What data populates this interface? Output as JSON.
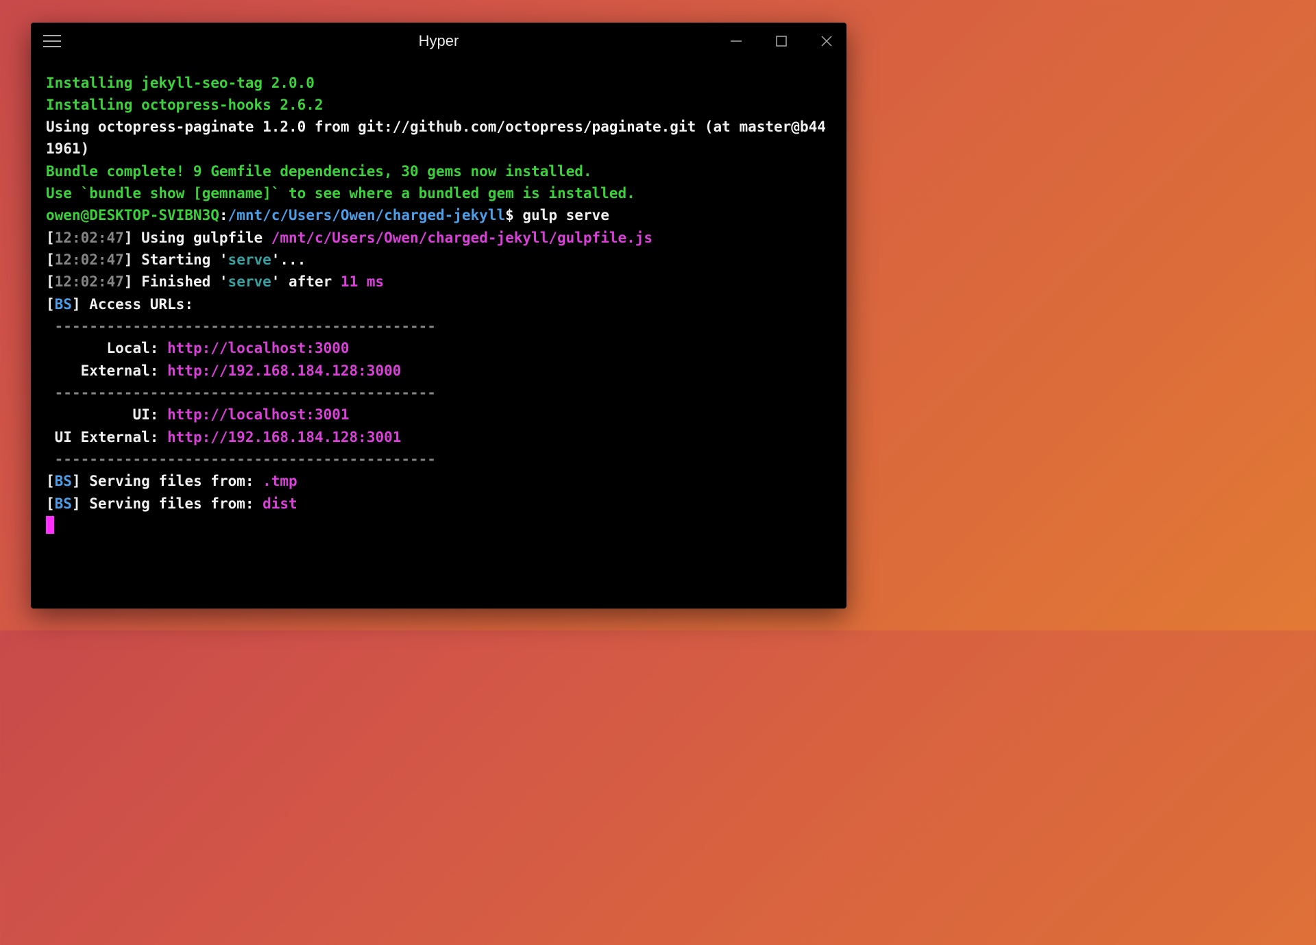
{
  "window": {
    "title": "Hyper"
  },
  "lines": {
    "l1": "Installing jekyll-seo-tag 2.0.0",
    "l2": "Installing octopress-hooks 2.6.2",
    "l3": "Using octopress-paginate 1.2.0 from git://github.com/octopress/paginate.git (at master@b441961)",
    "l4": "Bundle complete! 9 Gemfile dependencies, 30 gems now installed.",
    "l5": "Use `bundle show [gemname]` to see where a bundled gem is installed.",
    "prompt_user": "owen@DESKTOP-SVIBN3Q",
    "prompt_colon": ":",
    "prompt_path": "/mnt/c/Users/Owen/charged-jekyll",
    "prompt_symbol": "$",
    "prompt_cmd": " gulp serve",
    "g1_time": "12:02:47",
    "g1_text": " Using gulpfile ",
    "g1_path": "/mnt/c/Users/Owen/charged-jekyll/gulpfile.js",
    "g2_time": "12:02:47",
    "g2_a": " Starting '",
    "g2_task": "serve",
    "g2_b": "'...",
    "g3_time": "12:02:47",
    "g3_a": " Finished '",
    "g3_task": "serve",
    "g3_b": "' after ",
    "g3_dur": "11 ms",
    "bs_label": "BS",
    "bs_access": " Access URLs:",
    "divider": " --------------------------------------------",
    "url_local_lbl": "       Local: ",
    "url_local_val": "http://localhost:3000",
    "url_ext_lbl": "    External: ",
    "url_ext_val": "http://192.168.184.128:3000",
    "url_ui_lbl": "          UI: ",
    "url_ui_val": "http://localhost:3001",
    "url_uiext_lbl": " UI External: ",
    "url_uiext_val": "http://192.168.184.128:3001",
    "serve1_a": " Serving files from: ",
    "serve1_b": ".tmp",
    "serve2_a": " Serving files from: ",
    "serve2_b": "dist"
  }
}
